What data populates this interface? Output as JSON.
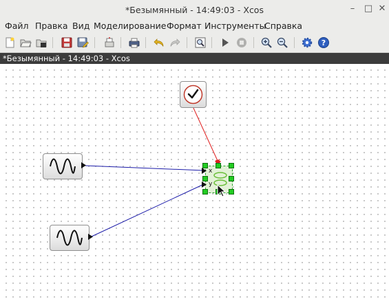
{
  "window": {
    "title": "*Безымянный - 14:49:03 - Xcos",
    "minimize_glyph": "–",
    "maximize_glyph": "□",
    "close_glyph": "✕"
  },
  "menu": {
    "file": "Файл",
    "edit": "Правка",
    "view": "Вид",
    "simulation": "Моделирование",
    "format": "Формат",
    "tools": "Инструменты",
    "help": "Справка"
  },
  "toolbar": {
    "icons": [
      "new-icon",
      "open-icon",
      "open-in-scilab-icon",
      "save-icon",
      "save-as-icon",
      "export-icon",
      "print-icon",
      "undo-icon",
      "redo-icon",
      "zoom-fit-icon",
      "start-icon",
      "stop-icon",
      "zoom-in-icon",
      "zoom-out-icon",
      "setup-icon",
      "help-icon"
    ]
  },
  "tab": {
    "title": "*Безымянный - 14:49:03 - Xcos"
  },
  "diagram": {
    "blocks": [
      "clock-block",
      "sine-generator-1",
      "sine-generator-2",
      "scope-xy-block"
    ],
    "port_labels": {
      "x": "x",
      "y": "y"
    },
    "colors": {
      "data_link": "#1a1aa8",
      "event_link": "#e02020",
      "selection_handle": "#22cc22",
      "tab_background": "#3c3c3c"
    }
  }
}
